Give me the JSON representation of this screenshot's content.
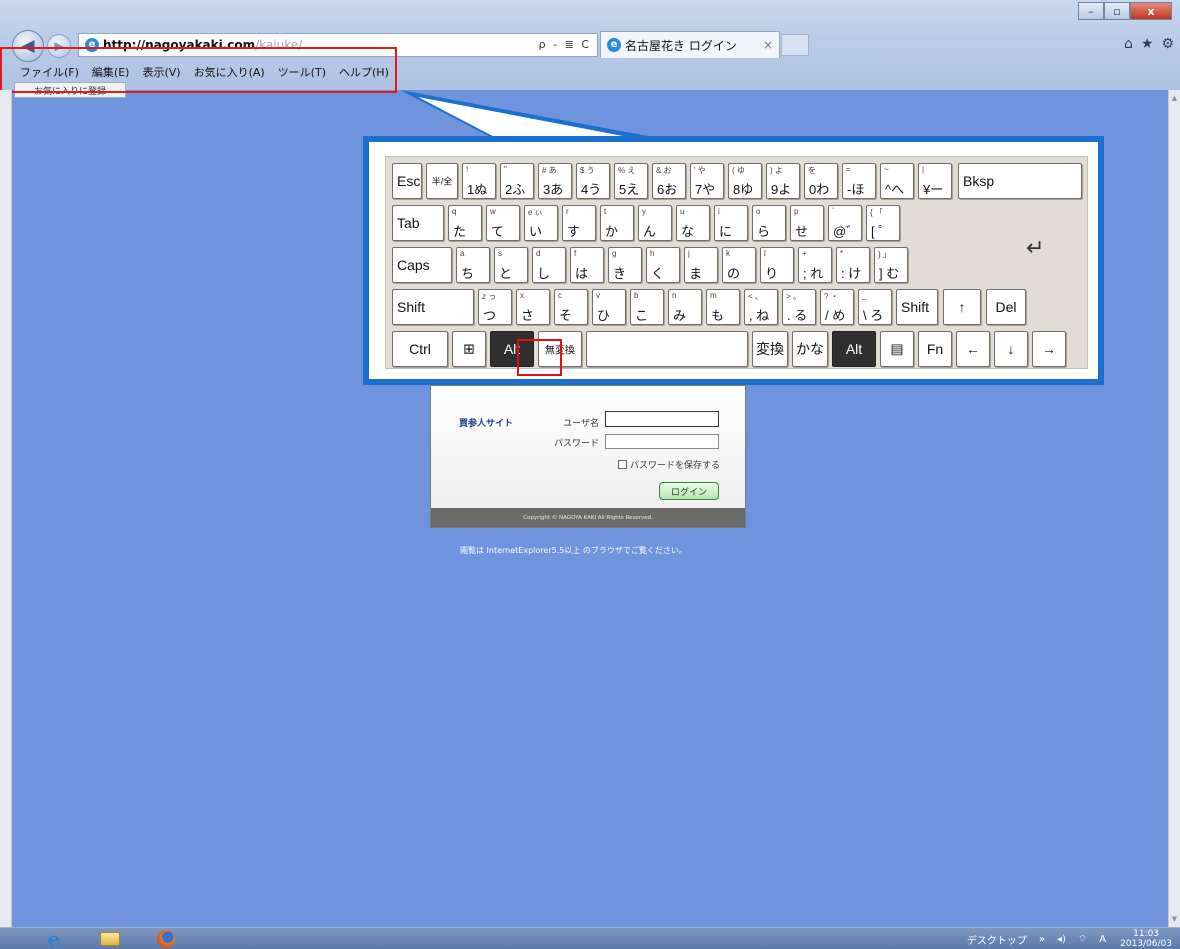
{
  "browser": {
    "url_host": "http://nagoyakaki.com",
    "url_path": "/kaiuke/",
    "addr_tools": "ρ - ≣ C",
    "tab_title": "名古屋花き ログイン",
    "tab_close": "×",
    "window_buttons": {
      "minimize": "–",
      "maximize": "▫",
      "close": "x"
    },
    "right_icons": {
      "home": "⌂",
      "favorites": "★",
      "tools": "⚙"
    },
    "menu": [
      "ファイル(F)",
      "編集(E)",
      "表示(V)",
      "お気に入り(A)",
      "ツール(T)",
      "ヘルプ(H)"
    ],
    "fav_bar_button": "お気に入りに登録"
  },
  "keyboard": {
    "row1": [
      {
        "main": "Esc"
      },
      {
        "main": "半/全"
      },
      {
        "top": "!",
        "bottom": "1",
        "ja": "ぬ"
      },
      {
        "top": "\"",
        "bottom": "2",
        "ja": "ふ"
      },
      {
        "top": "# あ",
        "bottom": "3",
        "ja": "あ"
      },
      {
        "top": "$ う",
        "bottom": "4",
        "ja": "う"
      },
      {
        "top": "% え",
        "bottom": "5",
        "ja": "え"
      },
      {
        "top": "& お",
        "bottom": "6",
        "ja": "お"
      },
      {
        "top": "' や",
        "bottom": "7",
        "ja": "や"
      },
      {
        "top": "( ゆ",
        "bottom": "8",
        "ja": "ゆ"
      },
      {
        "top": ") よ",
        "bottom": "9",
        "ja": "よ"
      },
      {
        "top": "を",
        "bottom": "0",
        "ja": "わ"
      },
      {
        "top": "=",
        "bottom": "-",
        "ja": "ほ"
      },
      {
        "top": "~",
        "bottom": "^",
        "ja": "へ"
      },
      {
        "top": "|",
        "bottom": "¥",
        "ja": "ー"
      },
      {
        "main": "Bksp"
      }
    ],
    "row2": [
      {
        "main": "Tab"
      },
      {
        "top": "q",
        "ja": "た"
      },
      {
        "top": "w",
        "ja": "て"
      },
      {
        "top": "e ぃ",
        "ja": "い"
      },
      {
        "top": "r",
        "ja": "す"
      },
      {
        "top": "t",
        "ja": "か"
      },
      {
        "top": "y",
        "ja": "ん"
      },
      {
        "top": "u",
        "ja": "な"
      },
      {
        "top": "i",
        "ja": "に"
      },
      {
        "top": "o",
        "ja": "ら"
      },
      {
        "top": "p",
        "ja": "せ"
      },
      {
        "top": "`",
        "ja": "@゛"
      },
      {
        "top": "{ 「",
        "ja": "[ ゜"
      }
    ],
    "row3": [
      {
        "main": "Caps"
      },
      {
        "top": "a",
        "ja": "ち"
      },
      {
        "top": "s",
        "ja": "と"
      },
      {
        "top": "d",
        "ja": "し"
      },
      {
        "top": "f",
        "ja": "は"
      },
      {
        "top": "g",
        "ja": "き"
      },
      {
        "top": "h",
        "ja": "く"
      },
      {
        "top": "j",
        "ja": "ま"
      },
      {
        "top": "k",
        "ja": "の"
      },
      {
        "top": "l",
        "ja": "り"
      },
      {
        "top": "+",
        "ja": "; れ"
      },
      {
        "top": "*",
        "ja": ": け"
      },
      {
        "top": "} 」",
        "ja": "] む"
      }
    ],
    "enter_arrow": "↵",
    "row4": [
      {
        "main": "Shift"
      },
      {
        "top": "z っ",
        "ja": "つ"
      },
      {
        "top": "x",
        "ja": "さ"
      },
      {
        "top": "c",
        "ja": "そ"
      },
      {
        "top": "v",
        "ja": "ひ"
      },
      {
        "top": "b",
        "ja": "こ"
      },
      {
        "top": "n",
        "ja": "み"
      },
      {
        "top": "m",
        "ja": "も"
      },
      {
        "top": "< 、",
        "ja": ", ね"
      },
      {
        "top": "> 。",
        "ja": ". る"
      },
      {
        "top": "? ・",
        "ja": "/ め"
      },
      {
        "top": "_",
        "ja": "\\ ろ"
      },
      {
        "main": "Shift"
      },
      {
        "main": "↑"
      },
      {
        "main": "Del"
      }
    ],
    "row5": [
      {
        "main": "Ctrl"
      },
      {
        "main": "⊞"
      },
      {
        "main": "Alt"
      },
      {
        "main": "無変換"
      },
      {
        "main": ""
      },
      {
        "main": "変換"
      },
      {
        "main": "かな"
      },
      {
        "main": "Alt"
      },
      {
        "main": "▤"
      },
      {
        "main": "Fn"
      },
      {
        "main": "←"
      },
      {
        "main": "↓"
      },
      {
        "main": "→"
      }
    ]
  },
  "login": {
    "site_name": "買参人サイト",
    "user_label": "ユーザ名",
    "pass_label": "パスワード",
    "save_password": "パスワードを保存する",
    "login_button": "ログイン",
    "copyright": "Copyright © NAGOYA KAKI All Rights Reserved.",
    "browser_note": "閲覧は InternetExplorer5.5以上 のブラウザでご覧ください。"
  },
  "taskbar": {
    "ie_icon": "e",
    "tray_desktop": "デスクトップ",
    "tray_chevron": "»",
    "tray_volume": "◂)",
    "tray_network": "⌔",
    "tray_ime": "A",
    "clock_time": "11:03",
    "clock_date": "2013/06/03"
  },
  "colors": {
    "page_bg": "#6f93dc",
    "callout_border": "#1a6fd0",
    "highlight_red": "#e11b1b",
    "alt_key_dark": "#2f2f2f"
  }
}
